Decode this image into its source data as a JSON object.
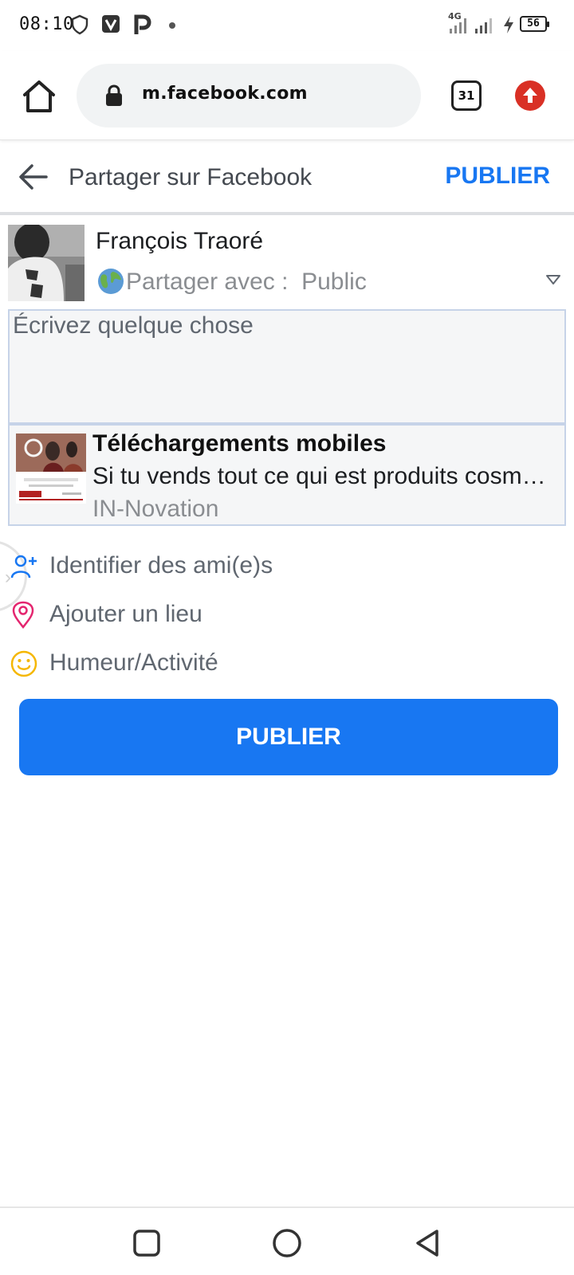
{
  "status_bar": {
    "time": "08:10",
    "network": "4G",
    "battery": "56",
    "icons": [
      "shield-icon",
      "v-app-icon",
      "p-app-icon",
      "notification-dot-icon",
      "signal-icon",
      "signal-icon",
      "charging-icon",
      "battery-icon"
    ]
  },
  "browser": {
    "url": "m.facebook.com",
    "tab_count": "31",
    "icons": [
      "home-icon",
      "lock-icon",
      "upload-arrow-icon"
    ]
  },
  "header": {
    "title": "Partager sur Facebook",
    "publish_label": "PUBLIER"
  },
  "post": {
    "user_name": "François Traoré",
    "privacy_label": "Partager avec :  Public",
    "composer_placeholder": "Écrivez quelque chose",
    "preview": {
      "title": "Téléchargements mobiles",
      "description": "Si tu vends tout ce qui est produits cosmétiques",
      "source": "IN-Novation",
      "thumb_caption": "AVEC IN-SPEED"
    }
  },
  "options": [
    {
      "label": "Identifier des ami(e)s",
      "icon": "add-friend-icon"
    },
    {
      "label": "Ajouter un lieu",
      "icon": "location-pin-icon"
    },
    {
      "label": "Humeur/Activité",
      "icon": "smiley-icon"
    }
  ],
  "publish_button": "PUBLIER",
  "colors": {
    "brand": "#1877f2",
    "upload_red": "#d93025",
    "location_pink": "#e4266f",
    "smiley_yellow": "#f5b700"
  }
}
